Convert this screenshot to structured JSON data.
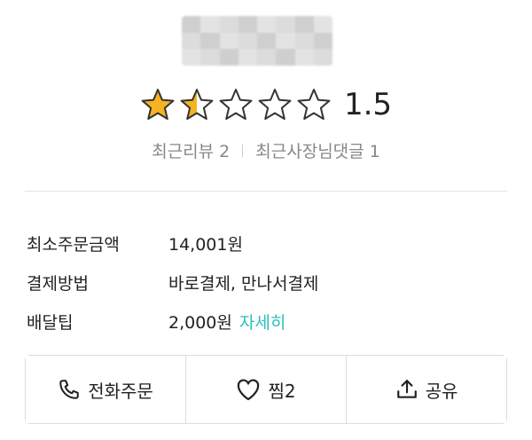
{
  "rating": {
    "value": 1.5,
    "display": "1.5",
    "max": 5,
    "filled_color": "#f5b320",
    "empty_color": "#ffffff",
    "outline_color": "#333333"
  },
  "reviews": {
    "recent_reviews": "최근리뷰 2",
    "owner_replies": "최근사장님댓글 1"
  },
  "info": {
    "rows": [
      {
        "label": "최소주문금액",
        "value": "14,001원"
      },
      {
        "label": "결제방법",
        "value": "바로결제, 만나서결제"
      },
      {
        "label": "배달팁",
        "value": "2,000원",
        "link": "자세히"
      }
    ]
  },
  "actions": {
    "call_label": "전화주문",
    "favorite_label": "찜2",
    "share_label": "공유",
    "call_icon": "phone-icon",
    "favorite_icon": "heart-icon",
    "share_icon": "share-icon"
  },
  "colors": {
    "accent": "#2ac1bc",
    "muted_text": "#888888"
  }
}
